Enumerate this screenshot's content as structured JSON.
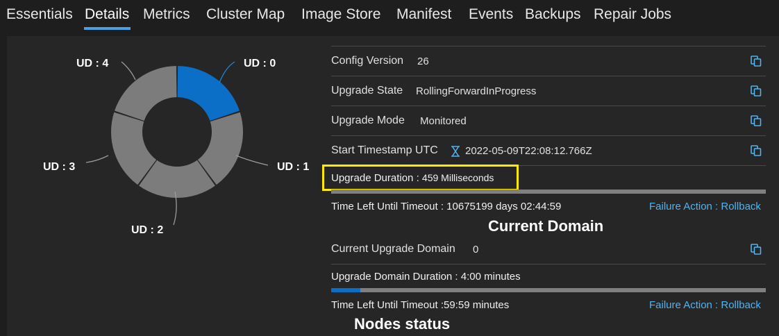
{
  "tabs": [
    "Essentials",
    "Details",
    "Metrics",
    "Cluster Map",
    "Image Store",
    "Manifest",
    "Events",
    "Backups",
    "Repair Jobs"
  ],
  "active_tab": "Details",
  "donut": {
    "labels": [
      "UD : 0",
      "UD : 1",
      "UD : 2",
      "UD : 3",
      "UD : 4"
    ],
    "active_index": 0,
    "active_color": "#0c6fc7",
    "inactive_color": "#7c7c7c"
  },
  "details": {
    "config_version": {
      "label": "Config Version",
      "value": "26"
    },
    "upgrade_state": {
      "label": "Upgrade State",
      "value": "RollingForwardInProgress"
    },
    "upgrade_mode": {
      "label": "Upgrade Mode",
      "value": "Monitored"
    },
    "start_timestamp": {
      "label": "Start Timestamp UTC",
      "value": "2022-05-09T22:08:12.766Z"
    },
    "upgrade_duration": {
      "label": "Upgrade Duration :",
      "value": "459 Milliseconds"
    },
    "upgrade_progress": 0,
    "time_left": "Time Left Until Timeout : 10675199 days 02:44:59",
    "failure_action": "Failure Action : Rollback"
  },
  "current_domain": {
    "heading": "Current Domain",
    "label": "Current Upgrade Domain",
    "value": "0",
    "duration": "Upgrade Domain Duration : 4:00 minutes",
    "progress": 0.067,
    "time_left": "Time Left Until Timeout :59:59 minutes",
    "failure_action": "Failure Action : Rollback"
  },
  "nodes_status": {
    "heading": "Nodes status"
  },
  "icons": {
    "copy": "copy-icon",
    "hourglass": "hourglass-icon"
  },
  "colors": {
    "accent": "#4aa0e6",
    "link": "#4fb4f0",
    "highlight": "#ffea00"
  }
}
